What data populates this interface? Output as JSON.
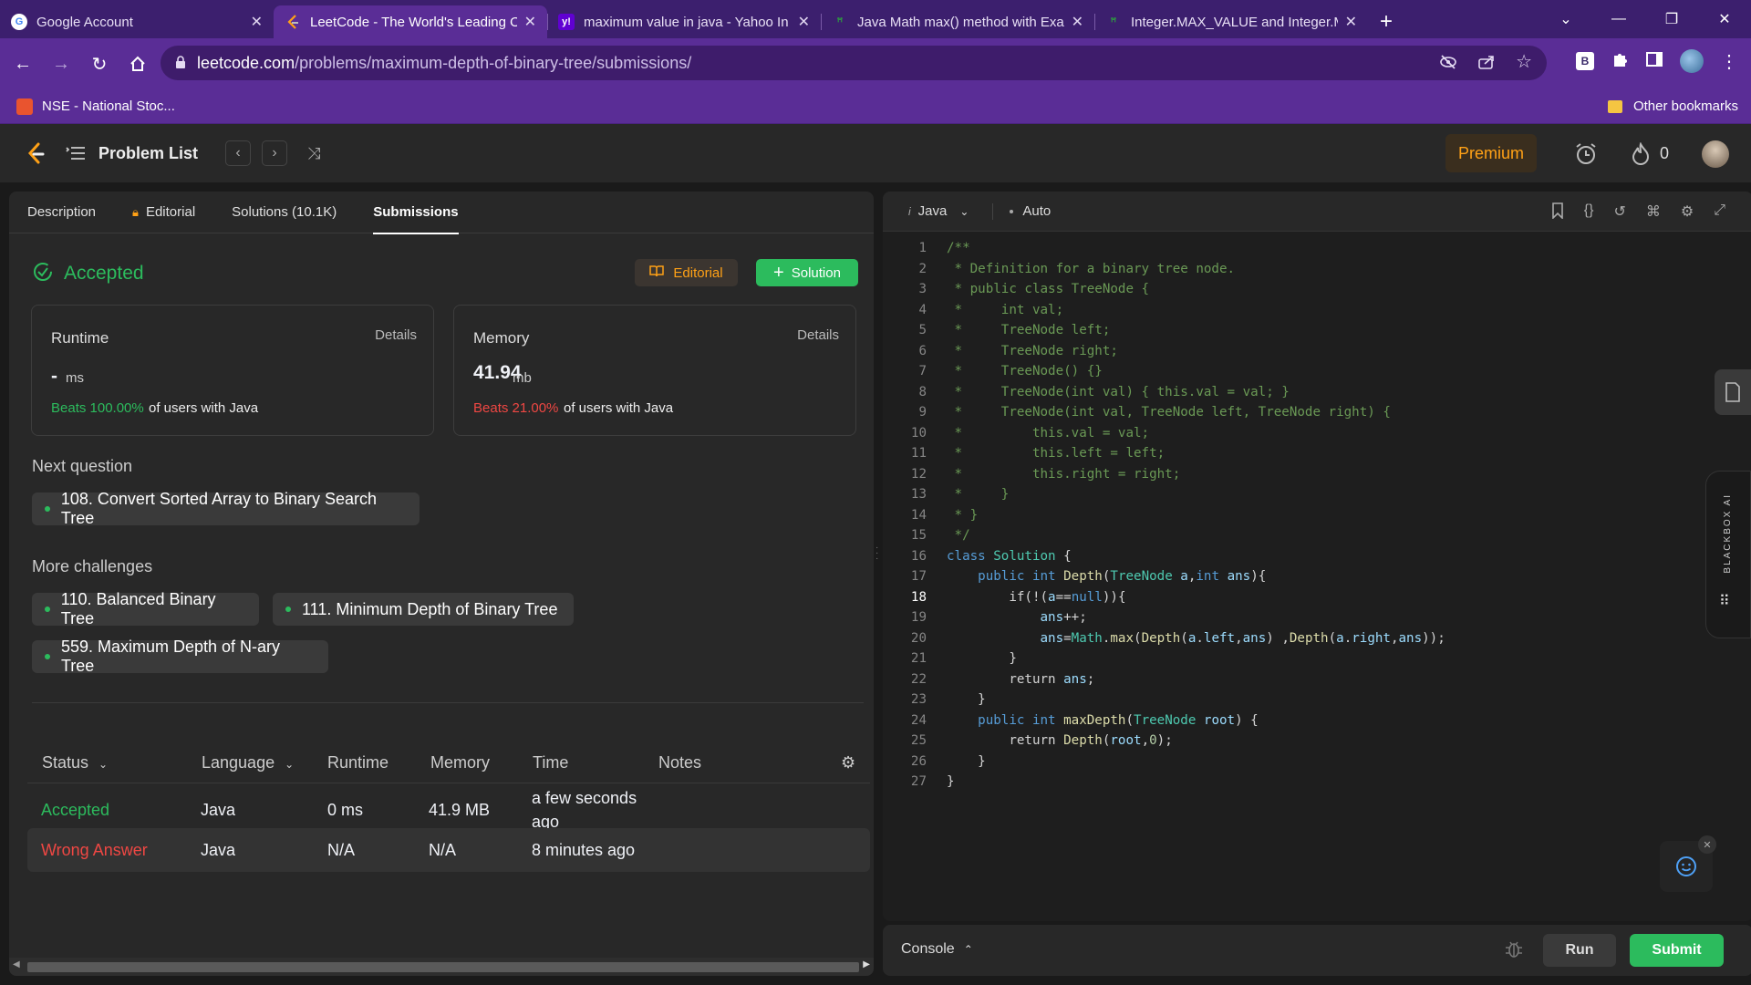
{
  "browser": {
    "tabs": [
      {
        "title": "Google Account",
        "icon": "google-icon"
      },
      {
        "title": "LeetCode - The World's Leading O",
        "icon": "leetcode-icon"
      },
      {
        "title": "maximum value in java - Yahoo In",
        "icon": "yahoo-icon"
      },
      {
        "title": "Java Math max() method with Exa",
        "icon": "javatpoint-icon"
      },
      {
        "title": "Integer.MAX_VALUE and Integer.M",
        "icon": "geeksforgeeks-icon"
      }
    ],
    "url_domain": "leetcode.com",
    "url_path": "/problems/maximum-depth-of-binary-tree/submissions/",
    "bookmark": "NSE - National Stoc...",
    "other_bookmarks": "Other bookmarks",
    "ext_b": "B"
  },
  "header": {
    "problem_list": "Problem List",
    "premium": "Premium",
    "streak": "0"
  },
  "left_tabs": {
    "description": "Description",
    "editorial": "Editorial",
    "solutions": "Solutions (10.1K)",
    "submissions": "Submissions"
  },
  "result": {
    "status": "Accepted",
    "editorial_btn": "Editorial",
    "solution_btn": "Solution",
    "runtime": {
      "label": "Runtime",
      "details": "Details",
      "value": "-",
      "unit": "ms",
      "beats": "Beats 100.00%",
      "suffix": "of users with Java"
    },
    "memory": {
      "label": "Memory",
      "details": "Details",
      "value": "41.94",
      "unit": "mb",
      "beats": "Beats 21.00%",
      "suffix": "of users with Java"
    }
  },
  "next_question": {
    "label": "Next question",
    "item": "108. Convert Sorted Array to Binary Search Tree"
  },
  "more_challenges": {
    "label": "More challenges",
    "items": [
      "110. Balanced Binary Tree",
      "111. Minimum Depth of Binary Tree",
      "559. Maximum Depth of N-ary Tree"
    ]
  },
  "table": {
    "headers": [
      "Status",
      "Language",
      "Runtime",
      "Memory",
      "Time",
      "Notes"
    ],
    "rows": [
      {
        "status": "Accepted",
        "language": "Java",
        "runtime": "0 ms",
        "memory": "41.9 MB",
        "time_line1": "a few seconds",
        "time_line2": "ago"
      },
      {
        "status": "Wrong Answer",
        "language": "Java",
        "runtime": "N/A",
        "memory": "N/A",
        "time_line1": "8 minutes ago",
        "time_line2": ""
      }
    ]
  },
  "editor": {
    "language": "Java",
    "mode": "Auto",
    "blackbox_label": "BLACKBOX AI"
  },
  "code_lines": [
    "/**",
    " * Definition for a binary tree node.",
    " * public class TreeNode {",
    " *     int val;",
    " *     TreeNode left;",
    " *     TreeNode right;",
    " *     TreeNode() {}",
    " *     TreeNode(int val) { this.val = val; }",
    " *     TreeNode(int val, TreeNode left, TreeNode right) {",
    " *         this.val = val;",
    " *         this.left = left;",
    " *         this.right = right;",
    " *     }",
    " * }",
    " */",
    "class Solution {",
    "    public int Depth(TreeNode a,int ans){",
    "        if(!(a==null)){",
    "            ans++;",
    "            ans=Math.max(Depth(a.left,ans) ,Depth(a.right,ans));",
    "        }",
    "        return ans;",
    "    }",
    "    public int maxDepth(TreeNode root) {",
    "        return Depth(root,0);",
    "    }",
    "}"
  ],
  "console": {
    "label": "Console",
    "run": "Run",
    "submit": "Submit"
  },
  "colors": {
    "accent_green": "#2cbb5d",
    "error_red": "#ef4743",
    "premium": "#ffa116",
    "chrome_purple": "#5a2d96"
  }
}
